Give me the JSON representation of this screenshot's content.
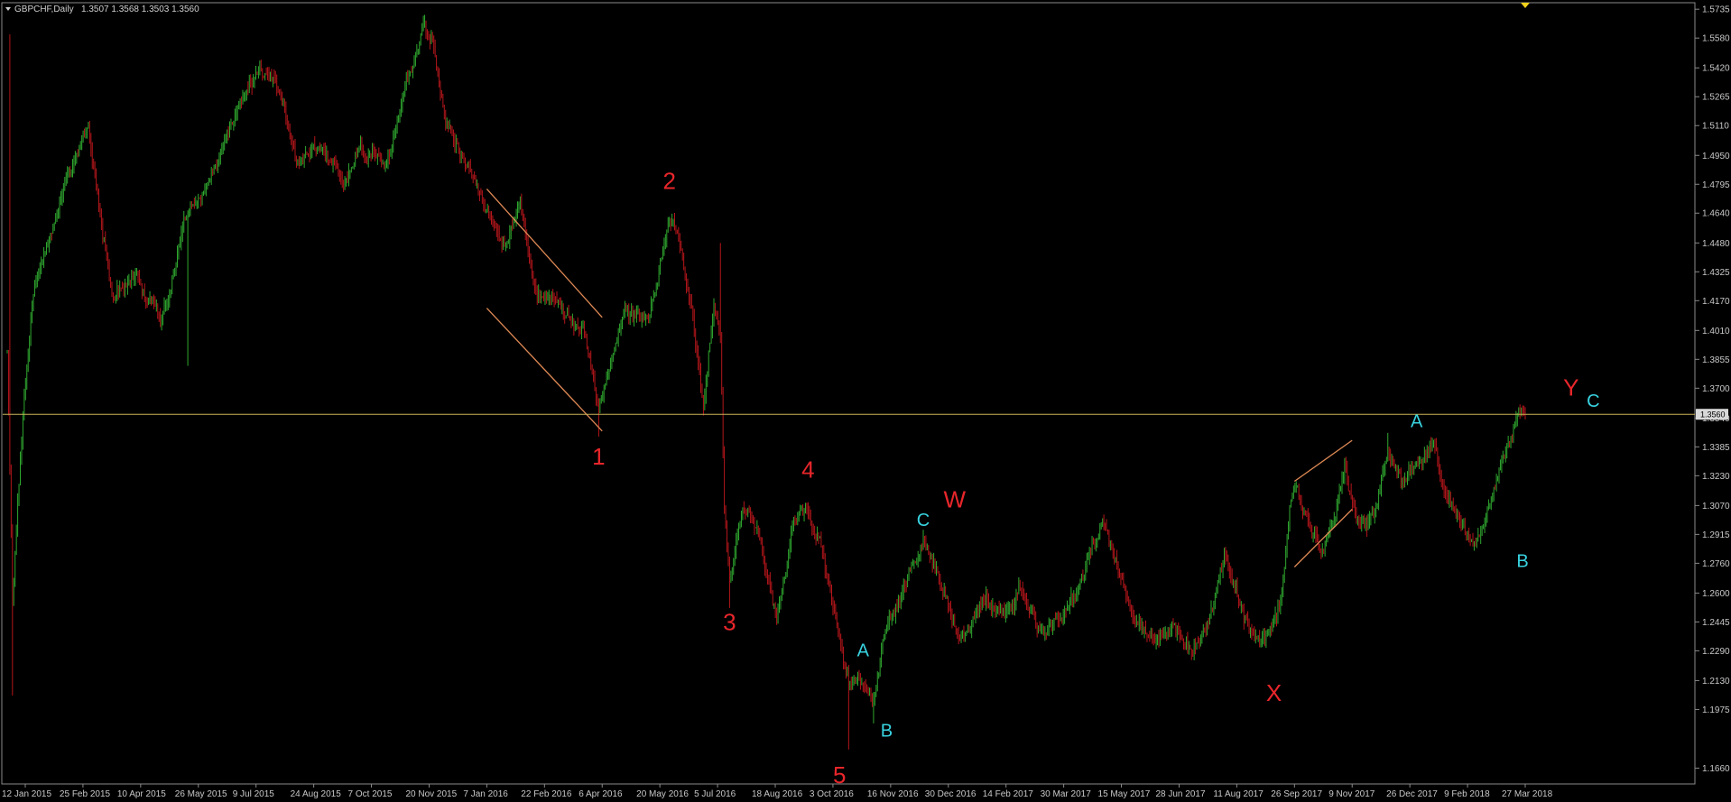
{
  "header": {
    "symbol": "GBPCHF,Daily",
    "ohlc": "1.3507 1.3568 1.3503 1.3560"
  },
  "colors": {
    "background": "#000000",
    "frame": "#8a8a8a",
    "bull": "#2fa82f",
    "bear": "#b4161b",
    "price_line": "#c9b458",
    "channel": "#e08a55",
    "wave_primary": "#e8262b",
    "wave_secondary": "#38d3e0",
    "marker": "#f2d21b"
  },
  "icons": {
    "menu": "triangle-down-icon",
    "marker": "triangle-down-icon"
  },
  "chart_data": {
    "type": "candlestick",
    "title": "GBPCHF,Daily",
    "ylim": [
      1.1575,
      1.5765
    ],
    "yticks": [
      "1.5735",
      "1.5580",
      "1.5420",
      "1.5265",
      "1.5110",
      "1.4950",
      "1.4795",
      "1.4640",
      "1.4480",
      "1.4325",
      "1.4170",
      "1.4010",
      "1.3855",
      "1.3700",
      "1.3540",
      "1.3385",
      "1.3230",
      "1.3070",
      "1.2915",
      "1.2760",
      "1.2600",
      "1.2445",
      "1.2290",
      "1.2130",
      "1.1975",
      "1.1660"
    ],
    "xticks": [
      "12 Jan 2015",
      "25 Feb 2015",
      "10 Apr 2015",
      "26 May 2015",
      "9 Jul 2015",
      "24 Aug 2015",
      "7 Oct 2015",
      "20 Nov 2015",
      "7 Jan 2016",
      "22 Feb 2016",
      "6 Apr 2016",
      "20 May 2016",
      "5 Jul 2016",
      "18 Aug 2016",
      "3 Oct 2016",
      "16 Nov 2016",
      "30 Dec 2016",
      "14 Feb 2017",
      "30 Mar 2017",
      "15 May 2017",
      "28 Jun 2017",
      "11 Aug 2017",
      "26 Sep 2017",
      "9 Nov 2017",
      "26 Dec 2017",
      "9 Feb 2018",
      "27 Mar 2018"
    ],
    "current_price": 1.356,
    "current_price_label": "1.3560",
    "anchors": [
      {
        "i": 0,
        "p": 1.39
      },
      {
        "i": 4,
        "p": 1.255
      },
      {
        "i": 12,
        "p": 1.355
      },
      {
        "i": 20,
        "p": 1.425
      },
      {
        "i": 45,
        "p": 1.48
      },
      {
        "i": 62,
        "p": 1.51
      },
      {
        "i": 80,
        "p": 1.42
      },
      {
        "i": 100,
        "p": 1.43
      },
      {
        "i": 118,
        "p": 1.405
      },
      {
        "i": 135,
        "p": 1.455
      },
      {
        "i": 150,
        "p": 1.475
      },
      {
        "i": 170,
        "p": 1.505
      },
      {
        "i": 185,
        "p": 1.535
      },
      {
        "i": 205,
        "p": 1.535
      },
      {
        "i": 222,
        "p": 1.495
      },
      {
        "i": 240,
        "p": 1.5
      },
      {
        "i": 258,
        "p": 1.48
      },
      {
        "i": 270,
        "p": 1.503
      },
      {
        "i": 290,
        "p": 1.485
      },
      {
        "i": 305,
        "p": 1.535
      },
      {
        "i": 318,
        "p": 1.565
      },
      {
        "i": 325,
        "p": 1.555
      },
      {
        "i": 335,
        "p": 1.51
      },
      {
        "i": 352,
        "p": 1.49
      },
      {
        "i": 368,
        "p": 1.465
      },
      {
        "i": 380,
        "p": 1.445
      },
      {
        "i": 392,
        "p": 1.47
      },
      {
        "i": 402,
        "p": 1.42
      },
      {
        "i": 420,
        "p": 1.415
      },
      {
        "i": 440,
        "p": 1.4
      },
      {
        "i": 452,
        "p": 1.355
      },
      {
        "i": 470,
        "p": 1.41
      },
      {
        "i": 490,
        "p": 1.41
      },
      {
        "i": 506,
        "p": 1.46
      },
      {
        "i": 515,
        "p": 1.445
      },
      {
        "i": 525,
        "p": 1.4
      },
      {
        "i": 532,
        "p": 1.36
      },
      {
        "i": 540,
        "p": 1.415
      },
      {
        "i": 545,
        "p": 1.4
      },
      {
        "i": 548,
        "p": 1.305
      },
      {
        "i": 552,
        "p": 1.27
      },
      {
        "i": 562,
        "p": 1.31
      },
      {
        "i": 575,
        "p": 1.29
      },
      {
        "i": 588,
        "p": 1.245
      },
      {
        "i": 602,
        "p": 1.3
      },
      {
        "i": 610,
        "p": 1.305
      },
      {
        "i": 622,
        "p": 1.285
      },
      {
        "i": 638,
        "p": 1.23
      },
      {
        "i": 643,
        "p": 1.212
      },
      {
        "i": 650,
        "p": 1.22
      },
      {
        "i": 662,
        "p": 1.2
      },
      {
        "i": 670,
        "p": 1.235
      },
      {
        "i": 685,
        "p": 1.262
      },
      {
        "i": 700,
        "p": 1.29
      },
      {
        "i": 712,
        "p": 1.27
      },
      {
        "i": 728,
        "p": 1.235
      },
      {
        "i": 745,
        "p": 1.255
      },
      {
        "i": 760,
        "p": 1.25
      },
      {
        "i": 775,
        "p": 1.26
      },
      {
        "i": 790,
        "p": 1.235
      },
      {
        "i": 808,
        "p": 1.25
      },
      {
        "i": 822,
        "p": 1.27
      },
      {
        "i": 838,
        "p": 1.3
      },
      {
        "i": 845,
        "p": 1.28
      },
      {
        "i": 860,
        "p": 1.25
      },
      {
        "i": 872,
        "p": 1.238
      },
      {
        "i": 890,
        "p": 1.24
      },
      {
        "i": 905,
        "p": 1.23
      },
      {
        "i": 918,
        "p": 1.245
      },
      {
        "i": 930,
        "p": 1.28
      },
      {
        "i": 945,
        "p": 1.245
      },
      {
        "i": 960,
        "p": 1.23
      },
      {
        "i": 972,
        "p": 1.25
      },
      {
        "i": 980,
        "p": 1.302
      },
      {
        "i": 985,
        "p": 1.315
      },
      {
        "i": 995,
        "p": 1.295
      },
      {
        "i": 1005,
        "p": 1.282
      },
      {
        "i": 1015,
        "p": 1.3
      },
      {
        "i": 1022,
        "p": 1.33
      },
      {
        "i": 1030,
        "p": 1.3
      },
      {
        "i": 1040,
        "p": 1.298
      },
      {
        "i": 1048,
        "p": 1.318
      },
      {
        "i": 1055,
        "p": 1.34
      },
      {
        "i": 1065,
        "p": 1.322
      },
      {
        "i": 1080,
        "p": 1.33
      },
      {
        "i": 1090,
        "p": 1.343
      },
      {
        "i": 1098,
        "p": 1.315
      },
      {
        "i": 1110,
        "p": 1.296
      },
      {
        "i": 1122,
        "p": 1.285
      },
      {
        "i": 1130,
        "p": 1.3
      },
      {
        "i": 1138,
        "p": 1.32
      },
      {
        "i": 1145,
        "p": 1.335
      },
      {
        "i": 1152,
        "p": 1.348
      },
      {
        "i": 1158,
        "p": 1.356
      }
    ],
    "wicks": [
      {
        "i": 4,
        "low": 1.205
      },
      {
        "i": 2,
        "high": 1.56
      },
      {
        "i": 138,
        "low": 1.382
      },
      {
        "i": 318,
        "high": 1.57
      },
      {
        "i": 452,
        "low": 1.344
      },
      {
        "i": 506,
        "high": 1.462
      },
      {
        "i": 545,
        "high": 1.448
      },
      {
        "i": 552,
        "low": 1.252
      },
      {
        "i": 643,
        "low": 1.176
      },
      {
        "i": 662,
        "low": 1.19
      },
      {
        "i": 905,
        "low": 1.224
      },
      {
        "i": 1055,
        "high": 1.346
      },
      {
        "i": 1122,
        "low": 1.285
      }
    ],
    "channels": [
      [
        {
          "date": "7 Jan 2016",
          "p": 1.477
        },
        {
          "date": "6 Apr 2016",
          "p": 1.408
        }
      ],
      [
        {
          "date": "7 Jan 2016",
          "p": 1.413
        },
        {
          "date": "6 Apr 2016",
          "p": 1.347
        }
      ],
      [
        {
          "date": "26 Sep 2017",
          "p": 1.32
        },
        {
          "date": "9 Nov 2017",
          "p": 1.342
        }
      ],
      [
        {
          "date": "26 Sep 2017",
          "p": 1.274
        },
        {
          "date": "9 Nov 2017",
          "p": 1.305
        }
      ]
    ],
    "wave_labels": [
      {
        "text": "1",
        "level": "primary",
        "i": 452,
        "p": 1.329
      },
      {
        "text": "2",
        "level": "primary",
        "i": 506,
        "p": 1.477
      },
      {
        "text": "3",
        "level": "primary",
        "i": 552,
        "p": 1.24
      },
      {
        "text": "4",
        "level": "primary",
        "i": 612,
        "p": 1.322
      },
      {
        "text": "5",
        "level": "primary",
        "i": 636,
        "p": 1.158
      },
      {
        "text": "W",
        "level": "primary",
        "i": 724,
        "p": 1.306
      },
      {
        "text": "X",
        "level": "primary",
        "i": 968,
        "p": 1.202
      },
      {
        "text": "Y",
        "level": "primary",
        "i": 1195,
        "p": 1.366
      },
      {
        "text": "A",
        "level": "secondary",
        "i": 654,
        "p": 1.226
      },
      {
        "text": "B",
        "level": "secondary",
        "i": 672,
        "p": 1.183
      },
      {
        "text": "C",
        "level": "secondary",
        "i": 700,
        "p": 1.296
      },
      {
        "text": "A",
        "level": "secondary",
        "i": 1077,
        "p": 1.349
      },
      {
        "text": "B",
        "level": "secondary",
        "i": 1158,
        "p": 1.274
      },
      {
        "text": "C",
        "level": "secondary",
        "i": 1212,
        "p": 1.36
      }
    ]
  }
}
